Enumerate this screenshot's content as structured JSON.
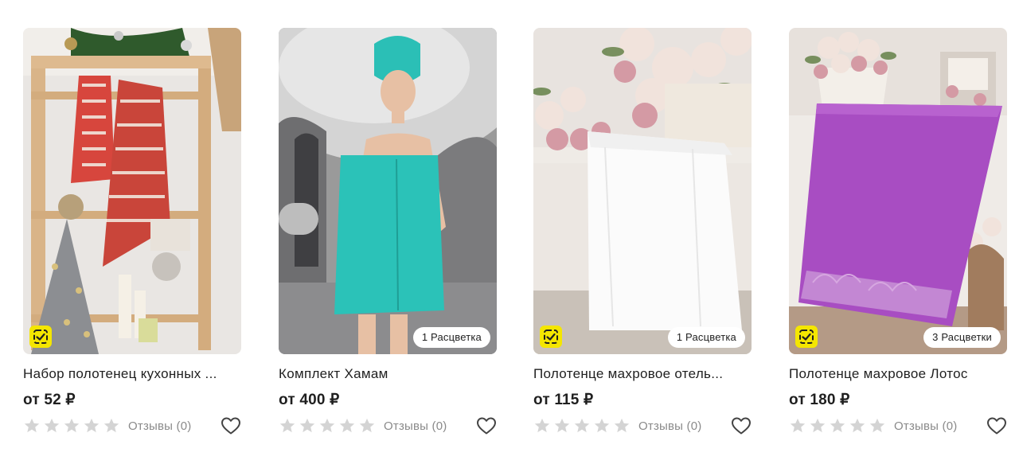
{
  "currency_prefix": "от",
  "cards": [
    {
      "title": "Набор полотенец кухонных ...",
      "price": "от 52 ₽",
      "rating": 0,
      "reviews": "Отзывы (0)",
      "has_check_badge": true,
      "colors_badge": ""
    },
    {
      "title": "Комплект Хамам",
      "price": "от 400 ₽",
      "rating": 0,
      "reviews": "Отзывы (0)",
      "has_check_badge": false,
      "colors_badge": "1 Расцветка"
    },
    {
      "title": "Полотенце махровое отель...",
      "price": "от 115 ₽",
      "rating": 0,
      "reviews": "Отзывы (0)",
      "has_check_badge": true,
      "colors_badge": "1 Расцветка"
    },
    {
      "title": "Полотенце махровое Лотос",
      "price": "от 180 ₽",
      "rating": 0,
      "reviews": "Отзывы (0)",
      "has_check_badge": true,
      "colors_badge": "3 Расцветки"
    }
  ],
  "icons": {
    "star": "star-icon",
    "favorite": "heart-icon",
    "verified": "check-badge-icon"
  },
  "colors": {
    "badge_yellow": "#f4e600",
    "star_empty": "#d4d4d4",
    "muted_text": "#8a8a8a"
  }
}
